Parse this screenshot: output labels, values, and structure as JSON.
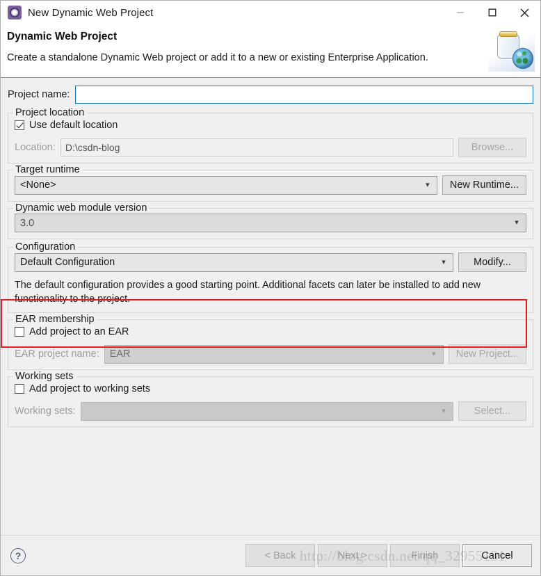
{
  "window": {
    "title": "New Dynamic Web Project",
    "icon": "eclipse-wizard-icon",
    "controls": {
      "minimize": "minimize-icon",
      "maximize": "maximize-icon",
      "close": "close-icon"
    }
  },
  "banner": {
    "title": "Dynamic Web Project",
    "description": "Create a standalone Dynamic Web project or add it to a new or existing Enterprise Application.",
    "image": "jar-globe-banner-icon"
  },
  "project_name": {
    "label": "Project name:",
    "value": "",
    "placeholder": ""
  },
  "project_location": {
    "legend": "Project location",
    "use_default_label": "Use default location",
    "use_default_checked": true,
    "location_label": "Location:",
    "location_value": "D:\\csdn-blog",
    "browse_label": "Browse...",
    "browse_enabled": false
  },
  "target_runtime": {
    "legend": "Target runtime",
    "value": "<None>",
    "new_runtime_label": "New Runtime..."
  },
  "module_version": {
    "legend": "Dynamic web module version",
    "value": "3.0",
    "highlighted": true,
    "highlight_color": "#e02020"
  },
  "configuration": {
    "legend": "Configuration",
    "value": "Default Configuration",
    "modify_label": "Modify...",
    "description": "The default configuration provides a good starting point. Additional facets can later be installed to add new functionality to the project."
  },
  "ear_membership": {
    "legend": "EAR membership",
    "add_to_ear_label": "Add project to an EAR",
    "add_to_ear_checked": false,
    "ear_name_label": "EAR project name:",
    "ear_name_value": "EAR",
    "new_project_label": "New Project...",
    "new_project_enabled": false
  },
  "working_sets": {
    "legend": "Working sets",
    "add_to_ws_label": "Add project to working sets",
    "add_to_ws_checked": false,
    "ws_label": "Working sets:",
    "ws_value": "",
    "select_label": "Select...",
    "select_enabled": false
  },
  "footer": {
    "help": "?",
    "back_label": "< Back",
    "back_enabled": false,
    "next_label": "Next >",
    "next_enabled": false,
    "finish_label": "Finish",
    "finish_enabled": false,
    "cancel_label": "Cancel",
    "cancel_enabled": true
  },
  "watermark": {
    "text": "http://blog.csdn.net/qq_32955131"
  }
}
